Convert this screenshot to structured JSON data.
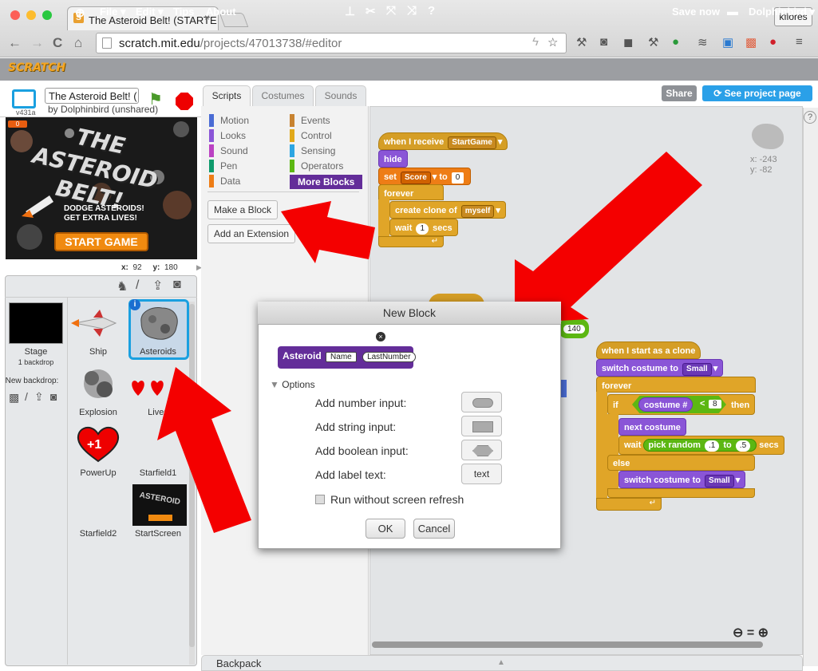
{
  "browser": {
    "tab_title": "The Asteroid Belt! (STARTE",
    "tab_close": "×",
    "user": "kflores",
    "url_host": "scratch.mit.edu",
    "url_path": "/projects/47013738/#editor",
    "back": "←",
    "forward": "→",
    "reload": "C",
    "home": "⌂"
  },
  "menubar": {
    "logo": "SCRATCH",
    "items": [
      "File ▾",
      "Edit ▾",
      "Tips",
      "About"
    ],
    "save": "Save now",
    "user": "Dolphinbird ▾"
  },
  "project": {
    "title": "The Asteroid Belt! (",
    "by": "by Dolphinbird (unshared)",
    "version": "v431a",
    "x_label": "x:",
    "x_value": "92",
    "y_label": "y:",
    "y_value": "180"
  },
  "stage_preview": {
    "score": "0",
    "title": "THE ASTEROID BELT!",
    "line1": "DODGE ASTEROIDS!",
    "line2": "GET EXTRA LIVES!",
    "button": "START GAME"
  },
  "sprites": {
    "stage_label": "Stage",
    "stage_sub": "1 backdrop",
    "new_backdrop": "New backdrop:",
    "list": [
      "Ship",
      "Asteroids",
      "Explosion",
      "Lives",
      "PowerUp",
      "Starfield1",
      "Starfield2",
      "StartScreen"
    ],
    "info": "i"
  },
  "tabs": [
    "Scripts",
    "Costumes",
    "Sounds"
  ],
  "categories": {
    "left": [
      "Motion",
      "Looks",
      "Sound",
      "Pen",
      "Data"
    ],
    "right": [
      "Events",
      "Control",
      "Sensing",
      "Operators",
      "More Blocks"
    ],
    "left_colors": [
      "#4a6cd4",
      "#8a55d7",
      "#bb42c3",
      "#0e9a6c",
      "#ee7d16"
    ],
    "right_colors": [
      "#c88330",
      "#e1a91a",
      "#2ca5e2",
      "#5cb712",
      "#632d99"
    ]
  },
  "palette_buttons": {
    "make_block": "Make a Block",
    "add_extension": "Add an Extension"
  },
  "toolbar": {
    "share": "Share",
    "see_page": "See project page"
  },
  "sprite_info": {
    "x": "x: -243",
    "y": "y: -82"
  },
  "script1": {
    "hat": "when I receive",
    "hat_msg": "StartGame",
    "hide": "hide",
    "set": "set",
    "set_var": "Score",
    "set_to": "to",
    "set_val": "0",
    "forever": "forever",
    "clone": "create clone of",
    "clone_of": "myself",
    "wait": "wait",
    "wait_val": "1",
    "secs": "secs"
  },
  "script2": {
    "hat": "when I start as a clone",
    "switch": "switch costume to",
    "costume": "Small",
    "forever": "forever",
    "if": "if",
    "then": "then",
    "costume_num": "costume #",
    "lt": "<",
    "lt_val": "8",
    "next": "next costume",
    "wait": "wait",
    "pick": "pick random",
    "from": ".1",
    "to": "to",
    "to_val": ".5",
    "secs": "secs",
    "else": "else",
    "switch2": "switch costume to",
    "costume2": "Small"
  },
  "hidden_block_value": "140",
  "dialog": {
    "title": "New Block",
    "block_name": "Asteroid",
    "param1": "Name",
    "param2": "LastNumber",
    "options": "Options",
    "add_number": "Add number input:",
    "add_string": "Add string input:",
    "add_boolean": "Add boolean input:",
    "add_label": "Add label text:",
    "label_btn": "text",
    "run_without": "Run without screen refresh",
    "ok": "OK",
    "cancel": "Cancel"
  },
  "backpack": "Backpack"
}
